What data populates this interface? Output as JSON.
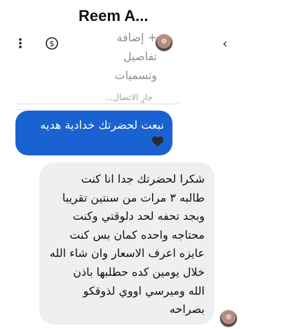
{
  "header": {
    "contact_name": "Reem A...",
    "subtitle_lines": [
      "+ إضافة",
      "تفاصيل",
      "وتسميات"
    ],
    "icons": {
      "back": "chevron-left-icon",
      "menu": "more-vertical-icon",
      "payment": "dollar-circle-icon",
      "avatar": "contact-avatar"
    }
  },
  "conversation": {
    "status_text": "جارٍ الاتصال...",
    "sent_message": {
      "text": "نبعت لحضرتك خدادية هديه",
      "emoji": "🖤",
      "bubble_color": "#1a62d1"
    },
    "received_message": {
      "lines": [
        "شكرا لحضرتك جدا انا كنت",
        "طالبه ٣ مرات من سنتين تقريبا",
        "وبجد تحفه لحد دلوقتي وكنت",
        "محتاجه واحده كمان بس كنت",
        "عايزه اعرف الاسعار وان شاء الله",
        "خلال يومين كده حطلبها باذن",
        "الله  وميرسي اووي لذوقكو",
        "بصراحه"
      ],
      "bubble_color": "#eeeff1"
    }
  }
}
